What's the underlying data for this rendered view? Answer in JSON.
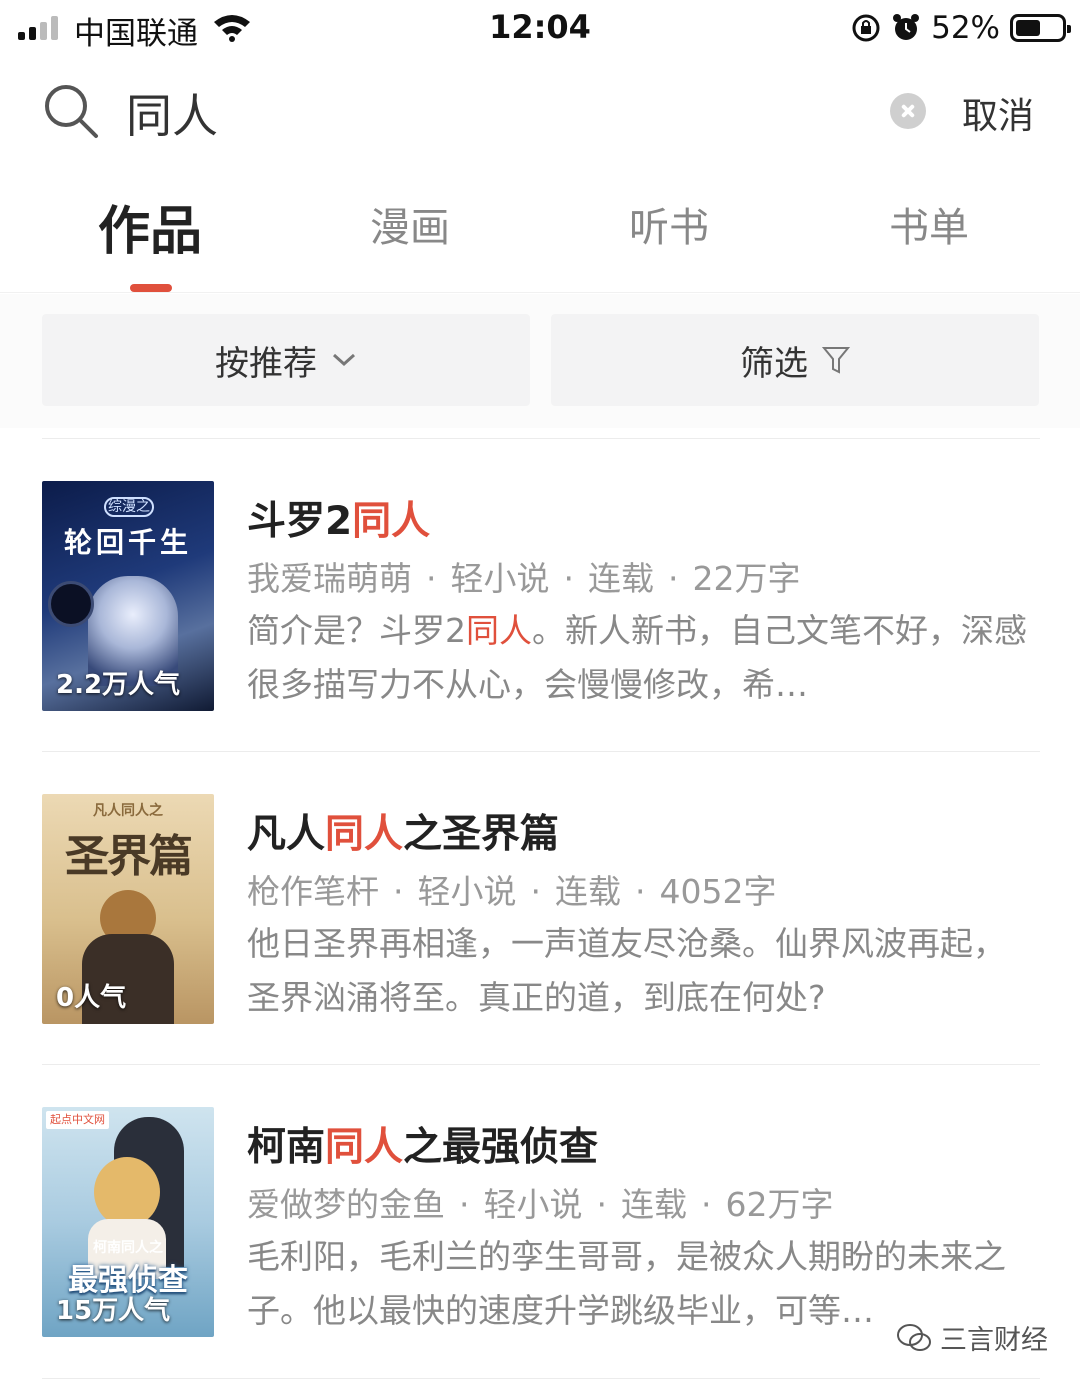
{
  "status_bar": {
    "carrier": "中国联通",
    "time": "12:04",
    "battery": "52%"
  },
  "search": {
    "query": "同人",
    "cancel_label": "取消"
  },
  "tabs": [
    {
      "label": "作品",
      "active": true
    },
    {
      "label": "漫画",
      "active": false
    },
    {
      "label": "听书",
      "active": false
    },
    {
      "label": "书单",
      "active": false
    }
  ],
  "filters": {
    "sort_label": "按推荐",
    "filter_label": "筛选"
  },
  "books": [
    {
      "title_before": "斗罗2",
      "title_highlight": "同人",
      "title_after": "",
      "author": "我爱瑞萌萌",
      "category": "轻小说",
      "status": "连载",
      "word_count": "22万字",
      "desc_before": "简介是？斗罗2",
      "desc_highlight": "同人",
      "desc_after": "。新人新书，自己文笔不好，深感很多描写力不从心，会慢慢修改，希…",
      "cover_popularity": "2.2万人气",
      "cover_title": "轮回千生",
      "cover_tag": "综漫之"
    },
    {
      "title_before": "凡人",
      "title_highlight": "同人",
      "title_after": "之圣界篇",
      "author": "枪作笔杆",
      "category": "轻小说",
      "status": "连载",
      "word_count": "4052字",
      "desc_before": "他日圣界再相逢，一声道友尽沧桑。仙界风波再起，圣界汹涌将至。真正的道，到底在何处?",
      "desc_highlight": "",
      "desc_after": "",
      "cover_popularity": "0人气",
      "cover_title": "圣界篇",
      "cover_tag": "凡人同人之"
    },
    {
      "title_before": "柯南",
      "title_highlight": "同人",
      "title_after": "之最强侦查",
      "author": "爱做梦的金鱼",
      "category": "轻小说",
      "status": "连载",
      "word_count": "62万字",
      "desc_before": "毛利阳，毛利兰的孪生哥哥，是被众人期盼的未来之子。他以最快的速度升学跳级毕业，可等…",
      "desc_highlight": "",
      "desc_after": "",
      "cover_popularity": "15万人气",
      "cover_title": "最强侦查",
      "cover_tag": "柯南同人之",
      "cover_brand": "起点中文网"
    }
  ],
  "watermark": "三言财经",
  "colors": {
    "accent": "#e0503c",
    "muted_text": "#999999"
  }
}
